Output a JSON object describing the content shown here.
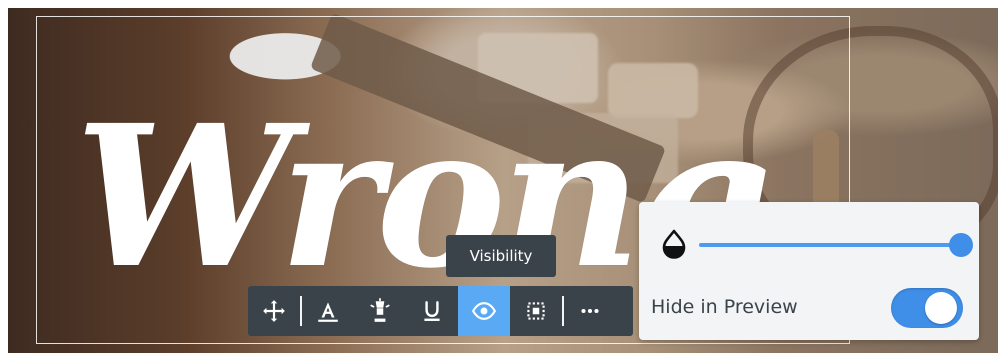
{
  "canvas": {
    "headline": "Wrong"
  },
  "tooltip": {
    "text": "Visibility"
  },
  "toolbar": {
    "buttons": [
      {
        "icon": "move-icon",
        "active": false
      },
      {
        "icon": "text-color-icon",
        "active": false
      },
      {
        "icon": "highlight-icon",
        "active": false
      },
      {
        "icon": "underline-icon",
        "active": false
      },
      {
        "icon": "eye-icon",
        "active": true
      },
      {
        "icon": "select-box-icon",
        "active": false
      },
      {
        "icon": "more-icon",
        "active": false
      }
    ],
    "accent": "#5aa9f5"
  },
  "visibility_panel": {
    "opacity": 1.0,
    "hide_in_preview_label": "Hide in Preview",
    "hide_in_preview": true,
    "toggle_color": "#3f8ee8"
  }
}
